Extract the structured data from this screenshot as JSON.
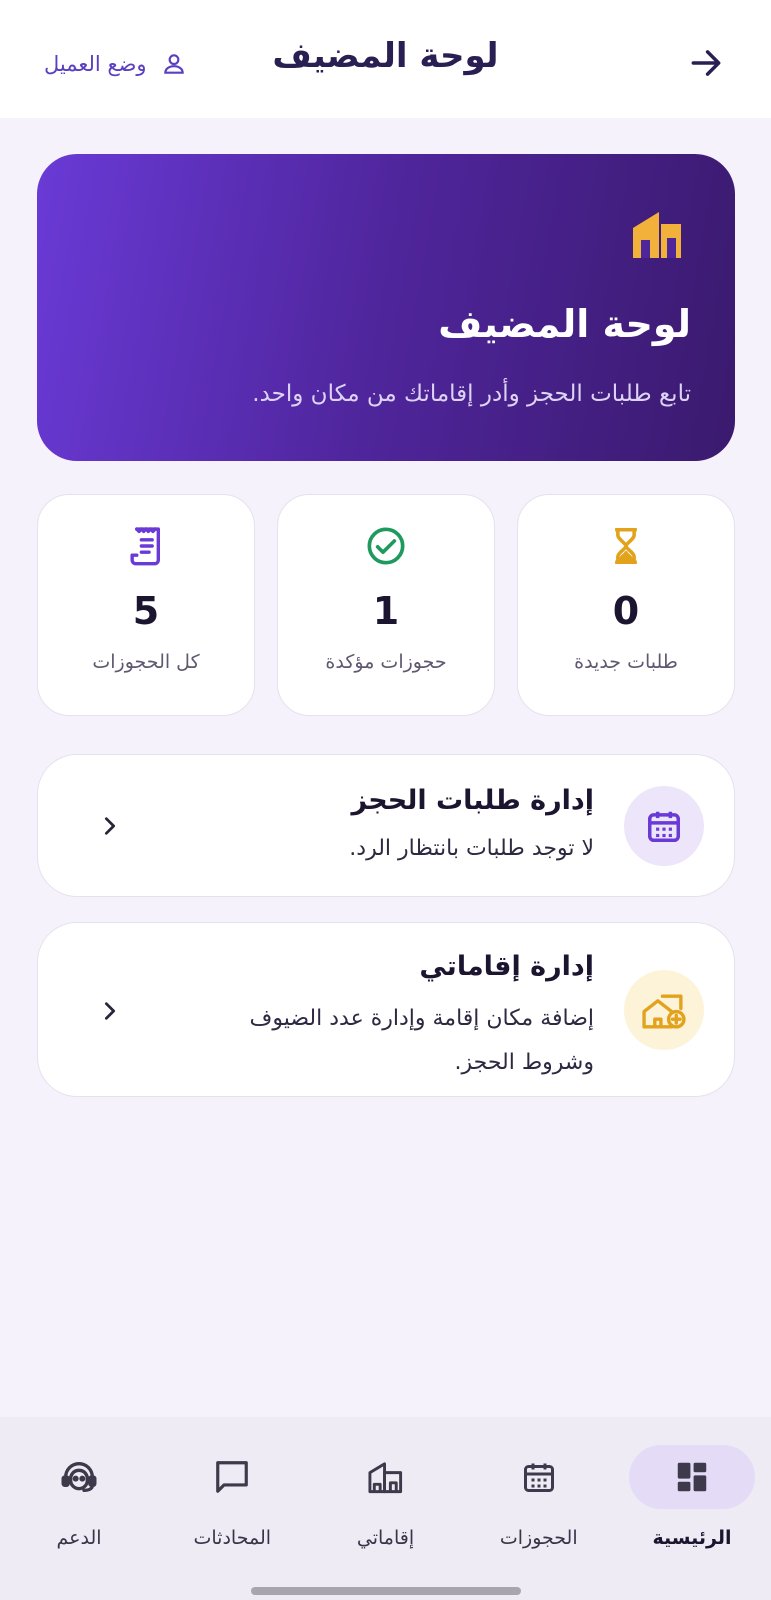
{
  "header": {
    "title": "لوحة المضيف",
    "client_mode_label": "وضع العميل",
    "back_icon": "arrow-right-icon",
    "client_icon": "person-icon"
  },
  "hero": {
    "title": "لوحة المضيف",
    "subtitle": "تابع طلبات الحجز وأدر إقاماتك من مكان واحد.",
    "icon": "building-icon"
  },
  "stats": [
    {
      "value": "0",
      "label": "طلبات جديدة",
      "icon": "hourglass-icon"
    },
    {
      "value": "1",
      "label": "حجوزات مؤكدة",
      "icon": "check-circle-icon"
    },
    {
      "value": "5",
      "label": "كل الحجوزات",
      "icon": "receipt-icon"
    }
  ],
  "cards": [
    {
      "title": "إدارة طلبات الحجز",
      "description": "لا توجد طلبات بانتظار الرد.",
      "icon": "calendar-icon"
    },
    {
      "title": "إدارة إقاماتي",
      "description": "إضافة مكان إقامة وإدارة عدد الضيوف وشروط الحجز.",
      "icon": "home-add-icon"
    }
  ],
  "nav": [
    {
      "label": "الرئيسية",
      "icon": "dashboard-icon",
      "active": true
    },
    {
      "label": "الحجوزات",
      "icon": "calendar-icon",
      "active": false
    },
    {
      "label": "إقاماتي",
      "icon": "building-icon",
      "active": false
    },
    {
      "label": "المحادثات",
      "icon": "chat-icon",
      "active": false
    },
    {
      "label": "الدعم",
      "icon": "support-agent-icon",
      "active": false
    }
  ],
  "colors": {
    "accent": "#6a3ad6",
    "gold": "#e2a21c",
    "success": "#1f9a5e",
    "page_bg": "#f5f2fb"
  }
}
